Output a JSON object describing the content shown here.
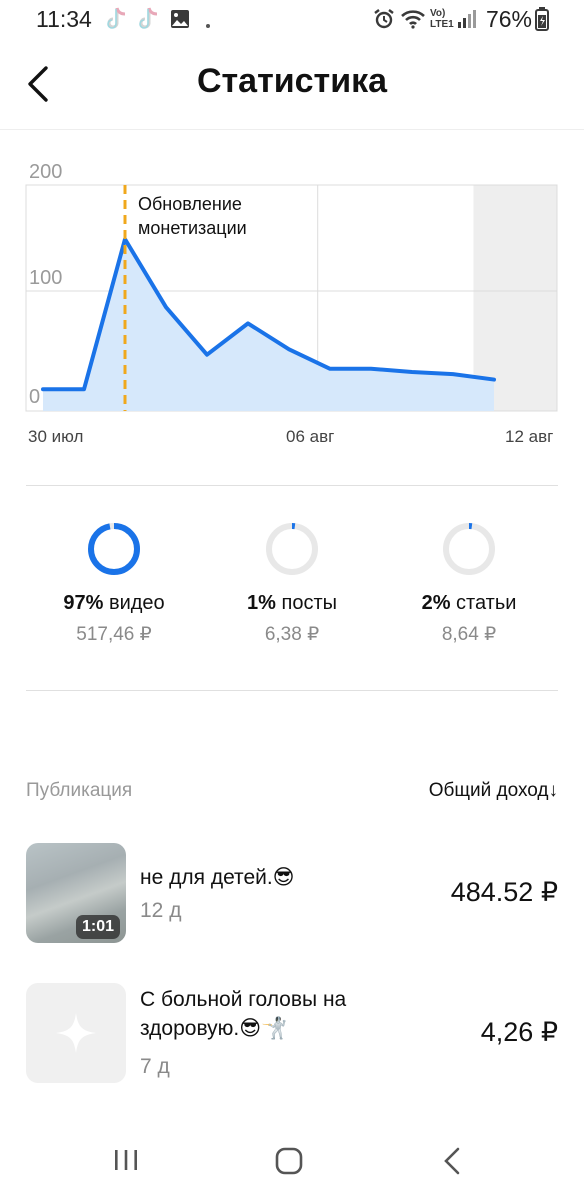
{
  "status_bar": {
    "time": "11:34",
    "battery": "76%",
    "icons": [
      "tiktok-icon",
      "tiktok-icon",
      "gallery-icon",
      "dot-icon",
      "alarm-icon",
      "wifi-icon",
      "volte-icon",
      "signal-icon",
      "battery-icon"
    ],
    "volte_label": "Vo)\nLTE1"
  },
  "header": {
    "title": "Статистика",
    "back_icon": "chevron-left-icon"
  },
  "chart_data": {
    "type": "area",
    "x_tick_labels": [
      "30 июл",
      "06 авг",
      "12 авг"
    ],
    "y_tick_labels": [
      "200",
      "100",
      "0"
    ],
    "ylim": [
      0,
      200
    ],
    "x": [
      "29 июл",
      "30 июл",
      "31 июл",
      "01 авг",
      "02 авг",
      "03 авг",
      "04 авг",
      "05 авг",
      "06 авг",
      "07 авг",
      "08 авг",
      "09 авг",
      "10 авг",
      "11 авг"
    ],
    "series": [
      {
        "values": [
          9,
          9,
          148,
          85,
          41,
          70,
          46,
          28,
          28,
          25,
          23,
          18
        ]
      }
    ],
    "annotation": {
      "label_line1": "Обновление",
      "label_line2": "монетизации",
      "x": "31 июл"
    },
    "grid": true,
    "colors": {
      "line": "#1a73e8",
      "fill": "#d6e8fb",
      "annotation": "#f0a81c",
      "future_region": "#eeeeee"
    }
  },
  "breakdown": [
    {
      "percent": "97%",
      "label": "видео",
      "amount": "517,46 ₽",
      "fraction": 0.97
    },
    {
      "percent": "1%",
      "label": "посты",
      "amount": "6,38 ₽",
      "fraction": 0.01
    },
    {
      "percent": "2%",
      "label": "статьи",
      "amount": "8,64 ₽",
      "fraction": 0.02
    }
  ],
  "list": {
    "col_left": "Публикация",
    "col_right": "Общий доход↓",
    "rows": [
      {
        "title": "не для детей.😎",
        "age": "12 д",
        "amount": "484.52 ₽",
        "duration": "1:01"
      },
      {
        "title_line1": "С больной головы на",
        "title_line2": "здоровую.😎🤺",
        "age": "7 д",
        "amount": "4,26 ₽"
      }
    ]
  },
  "nav": {
    "icons": [
      "recent-apps-icon",
      "home-icon",
      "back-icon"
    ]
  },
  "colors": {
    "accent": "#1a73e8",
    "ring_track": "#e8e8e8"
  }
}
